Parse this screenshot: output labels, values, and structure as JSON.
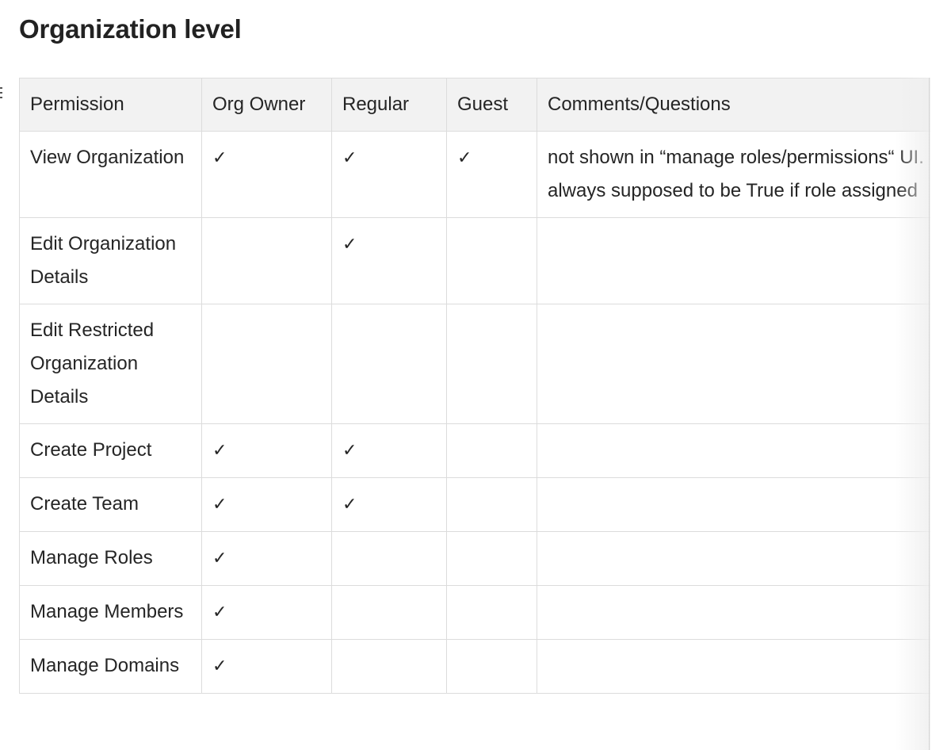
{
  "section": {
    "title": "Organization level"
  },
  "table": {
    "headers": [
      "Permission",
      "Org Owner",
      "Regular",
      "Guest",
      "Comments/Questions"
    ],
    "rows": [
      {
        "permission": "View Organization",
        "org_owner": "✓",
        "regular": "✓",
        "guest": "✓",
        "comments": "not shown in “manage roles/permissions“ UI. always supposed to be True if role assigned"
      },
      {
        "permission": "Edit Organization Details",
        "org_owner": "",
        "regular": "✓",
        "guest": "",
        "comments": ""
      },
      {
        "permission": "Edit Restricted Organization Details",
        "org_owner": "",
        "regular": "",
        "guest": "",
        "comments": ""
      },
      {
        "permission": "Create Project",
        "org_owner": "✓",
        "regular": "✓",
        "guest": "",
        "comments": ""
      },
      {
        "permission": "Create Team",
        "org_owner": "✓",
        "regular": "✓",
        "guest": "",
        "comments": ""
      },
      {
        "permission": "Manage Roles",
        "org_owner": "✓",
        "regular": "",
        "guest": "",
        "comments": ""
      },
      {
        "permission": "Manage Members",
        "org_owner": "✓",
        "regular": "",
        "guest": "",
        "comments": ""
      },
      {
        "permission": "Manage Domains",
        "org_owner": "✓",
        "regular": "",
        "guest": "",
        "comments": ""
      }
    ]
  },
  "icons": {
    "check": "check-icon",
    "row_handle": "drag-handle-icon"
  },
  "colors": {
    "header_bg": "#f2f2f2",
    "border": "#dcdcdc",
    "text": "#252525"
  }
}
